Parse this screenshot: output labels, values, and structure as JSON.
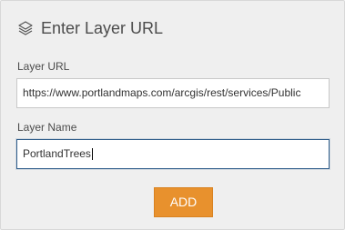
{
  "header": {
    "icon": "layers-icon",
    "title": "Enter Layer URL"
  },
  "url_field": {
    "label": "Layer URL",
    "value": "https://www.portlandmaps.com/arcgis/rest/services/Public"
  },
  "name_field": {
    "label": "Layer Name",
    "value": "PortlandTrees"
  },
  "add_button": {
    "label": "ADD"
  },
  "colors": {
    "panel_bg": "#efefef",
    "accent": "#e8912d",
    "focus_border": "#2f5d8a"
  }
}
